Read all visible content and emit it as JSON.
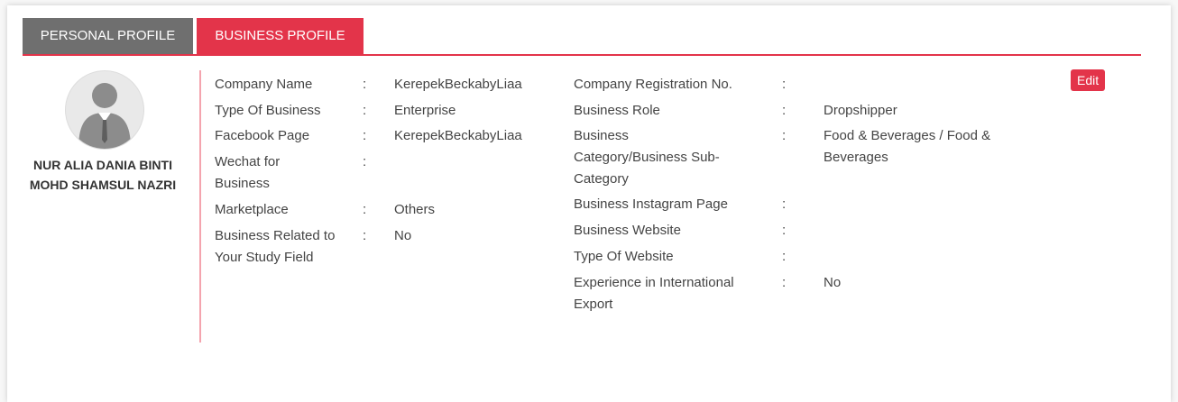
{
  "tabs": {
    "personal": "PERSONAL PROFILE",
    "business": "BUSINESS PROFILE"
  },
  "profile": {
    "name": "NUR ALIA DANIA BINTI MOHD SHAMSUL NAZRI"
  },
  "actions": {
    "edit": "Edit"
  },
  "separator": ":",
  "left_fields": [
    {
      "label": "Company Name",
      "value": "KerepekBeckabyLiaa"
    },
    {
      "label": "Type Of Business",
      "value": "Enterprise"
    },
    {
      "label": "Facebook Page",
      "value": "KerepekBeckabyLiaa"
    },
    {
      "label": "Wechat for Business",
      "value": ""
    },
    {
      "label": "Marketplace",
      "value": "Others"
    },
    {
      "label": "Business Related to Your Study Field",
      "value": "No"
    }
  ],
  "right_fields": [
    {
      "label": "Company Registration No.",
      "value": ""
    },
    {
      "label": "Business Role",
      "value": "Dropshipper"
    },
    {
      "label": "Business Category/Business Sub-Category",
      "value": "Food & Beverages / Food & Beverages"
    },
    {
      "label": "Business Instagram Page",
      "value": ""
    },
    {
      "label": "Business Website",
      "value": ""
    },
    {
      "label": "Type Of Website",
      "value": ""
    },
    {
      "label": "Experience in International Export",
      "value": "No"
    }
  ],
  "colors": {
    "accent": "#e3344a",
    "inactive_tab": "#6f6f6f",
    "divider": "#f4a4ae"
  }
}
